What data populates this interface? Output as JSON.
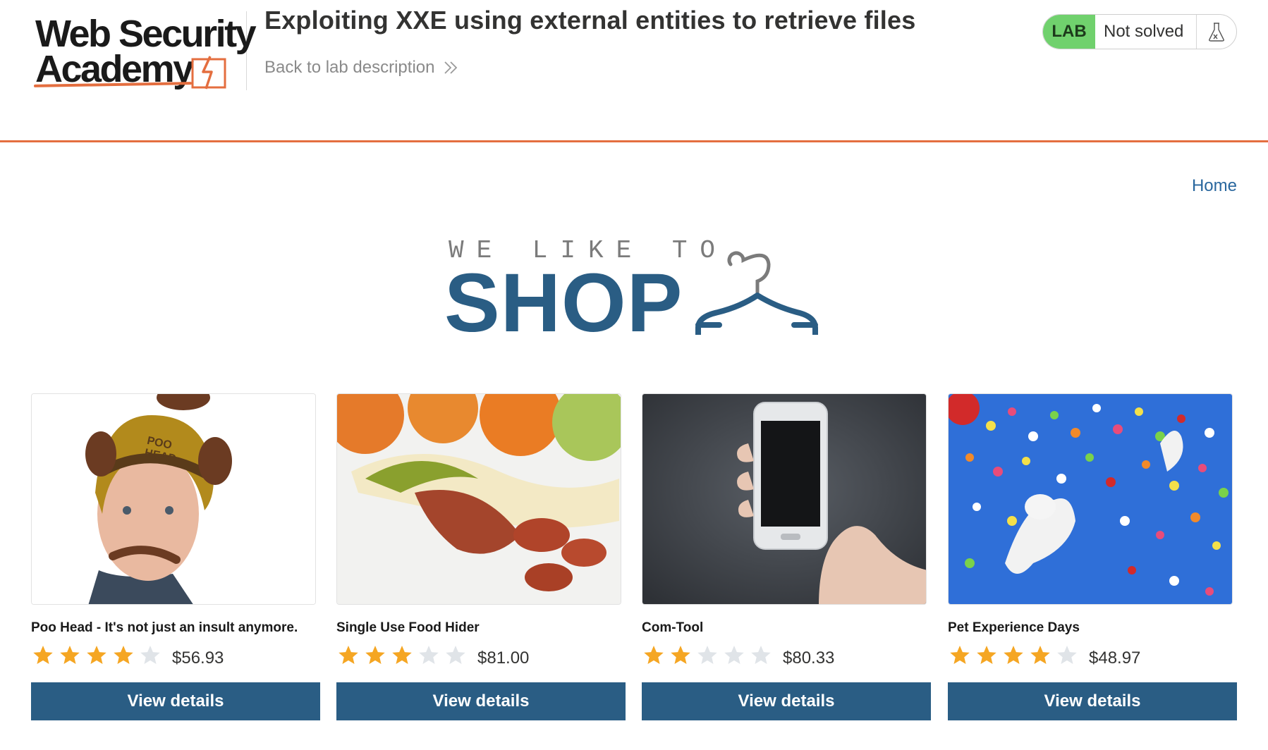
{
  "academy": {
    "logo_line1": "Web Security",
    "logo_line2": "Academy",
    "lab_title": "Exploiting XXE using external entities to retrieve files",
    "back_link": "Back to lab description",
    "lab_badge": "LAB",
    "lab_status": "Not solved",
    "icons": {
      "back": "double-chevron-right-icon",
      "status": "flask-icon"
    },
    "colors": {
      "accent": "#e46e3f",
      "badge": "#70d16d"
    }
  },
  "nav": {
    "home": "Home"
  },
  "banner": {
    "tagline": "WE LIKE TO",
    "word": "SHOP",
    "icon": "hanger-icon",
    "color": "#2a5d84"
  },
  "products": [
    {
      "name": "Poo Head - It's not just an insult anymore.",
      "rating": 4,
      "max_rating": 5,
      "price": "$56.93",
      "button": "View details"
    },
    {
      "name": "Single Use Food Hider",
      "rating": 3,
      "max_rating": 5,
      "price": "$81.00",
      "button": "View details"
    },
    {
      "name": "Com-Tool",
      "rating": 2,
      "max_rating": 5,
      "price": "$80.33",
      "button": "View details"
    },
    {
      "name": "Pet Experience Days",
      "rating": 4,
      "max_rating": 5,
      "price": "$48.97",
      "button": "View details"
    }
  ],
  "colors": {
    "button": "#2a5d84",
    "star_on": "#f5a623",
    "star_off": "#e0e4e8",
    "link": "#29679e"
  }
}
